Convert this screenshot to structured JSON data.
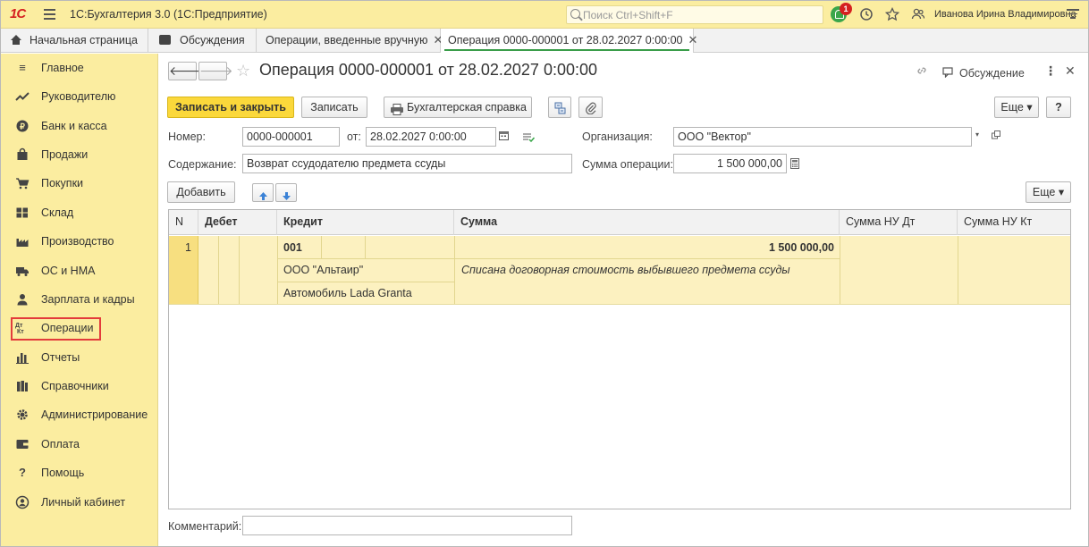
{
  "app": {
    "logo": "1С",
    "title": "1С:Бухгалтерия 3.0  (1С:Предприятие)",
    "search_placeholder": "Поиск Ctrl+Shift+F",
    "notification_count": "1",
    "user": "Иванова Ирина Владимировна"
  },
  "tabs": [
    {
      "label": "Начальная страница"
    },
    {
      "label": "Обсуждения"
    },
    {
      "label": "Операции, введенные вручную"
    },
    {
      "label": "Операция 0000-000001 от 28.02.2027 0:00:00"
    }
  ],
  "sidebar": {
    "items": [
      {
        "label": "Главное",
        "icon": "menu-lines-icon"
      },
      {
        "label": "Руководителю",
        "icon": "trend-up-icon"
      },
      {
        "label": "Банк и касса",
        "icon": "coin-icon"
      },
      {
        "label": "Продажи",
        "icon": "shopping-bag-icon"
      },
      {
        "label": "Покупки",
        "icon": "cart-icon"
      },
      {
        "label": "Склад",
        "icon": "warehouse-grid-icon"
      },
      {
        "label": "Производство",
        "icon": "factory-icon"
      },
      {
        "label": "ОС и НМА",
        "icon": "truck-icon"
      },
      {
        "label": "Зарплата и кадры",
        "icon": "person-icon"
      },
      {
        "label": "Операции",
        "icon": "debit-credit-icon"
      },
      {
        "label": "Отчеты",
        "icon": "bar-chart-icon"
      },
      {
        "label": "Справочники",
        "icon": "books-icon"
      },
      {
        "label": "Администрирование",
        "icon": "gear-icon"
      },
      {
        "label": "Оплата",
        "icon": "wallet-icon"
      },
      {
        "label": "Помощь",
        "icon": "question-icon"
      },
      {
        "label": "Личный кабинет",
        "icon": "account-circle-icon"
      }
    ],
    "selected": "Операции"
  },
  "document": {
    "title": "Операция 0000-000001 от 28.02.2027 0:00:00",
    "discussion_label": "Обсуждение",
    "toolbar": {
      "save_close": "Записать и закрыть",
      "save": "Записать",
      "accounting_report": "Бухгалтерская справка",
      "more": "Еще",
      "help": "?"
    },
    "fields": {
      "number_label": "Номер:",
      "number_value": "0000-000001",
      "date_label": "от:",
      "date_value": "28.02.2027  0:00:00",
      "org_label": "Организация:",
      "org_value": "ООО \"Вектор\"",
      "content_label": "Содержание:",
      "content_value": "Возврат ссудодателю предмета ссуды",
      "amount_label": "Сумма операции:",
      "amount_value": "1 500 000,00",
      "comment_label": "Комментарий:",
      "comment_value": ""
    },
    "table_toolbar": {
      "add": "Добавить",
      "more": "Еще"
    },
    "table": {
      "columns": [
        "N",
        "Дебет",
        "Кредит",
        "Сумма",
        "Сумма НУ Дт",
        "Сумма НУ Кт"
      ],
      "rows": [
        {
          "n": "1",
          "credit_account": "001",
          "credit_subconto1": "ООО \"Альтаир\"",
          "credit_subconto2": "Автомобиль Lada Granta",
          "amount": "1 500 000,00",
          "description": "Списана договорная стоимость выбывшего предмета ссуды"
        }
      ]
    }
  }
}
